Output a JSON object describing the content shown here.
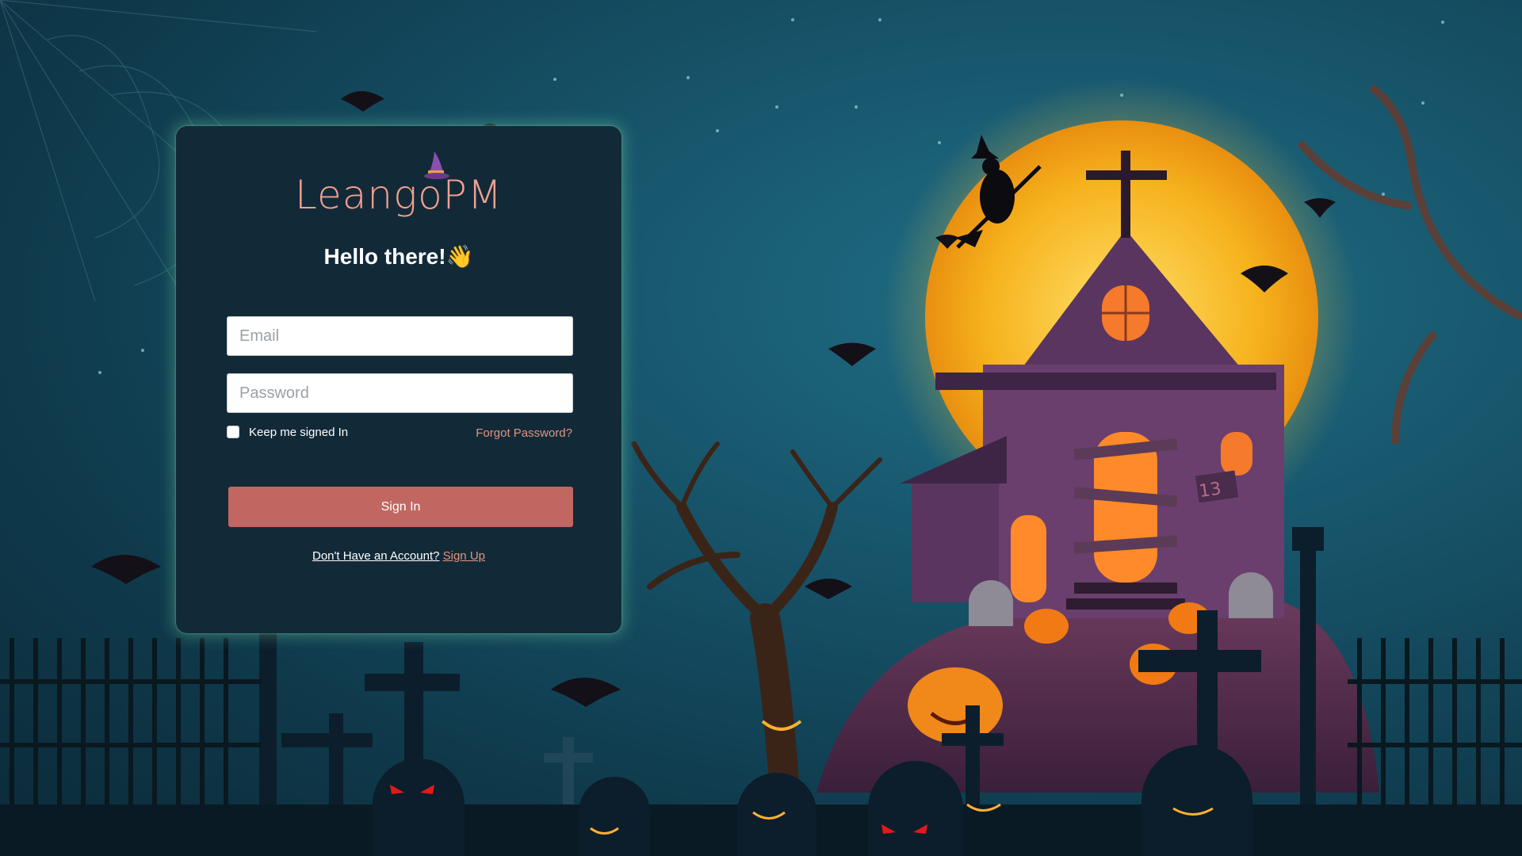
{
  "brand": {
    "name": "LeangoPM",
    "hat_icon": "witch-hat-icon"
  },
  "login": {
    "greeting": "Hello there!",
    "greeting_emoji": "👋",
    "email_placeholder": "Email",
    "password_placeholder": "Password",
    "keep_signed_in": "Keep me signed In",
    "forgot_password": "Forgot Password?",
    "sign_in": "Sign In",
    "no_account": "Don't Have an Account?",
    "sign_up": "Sign Up"
  },
  "colors": {
    "accent": "#c26662",
    "link": "#e2947e",
    "card": "#122a38",
    "moon": "#f6b21c",
    "background": "#17546a"
  },
  "background_scene": {
    "icons": [
      "moon",
      "haunted-house",
      "witch-on-broom",
      "bats",
      "graveyard-crosses",
      "jack-o-lanterns",
      "spooky-tree",
      "spider-web",
      "iron-fence"
    ],
    "house_number": "13"
  }
}
